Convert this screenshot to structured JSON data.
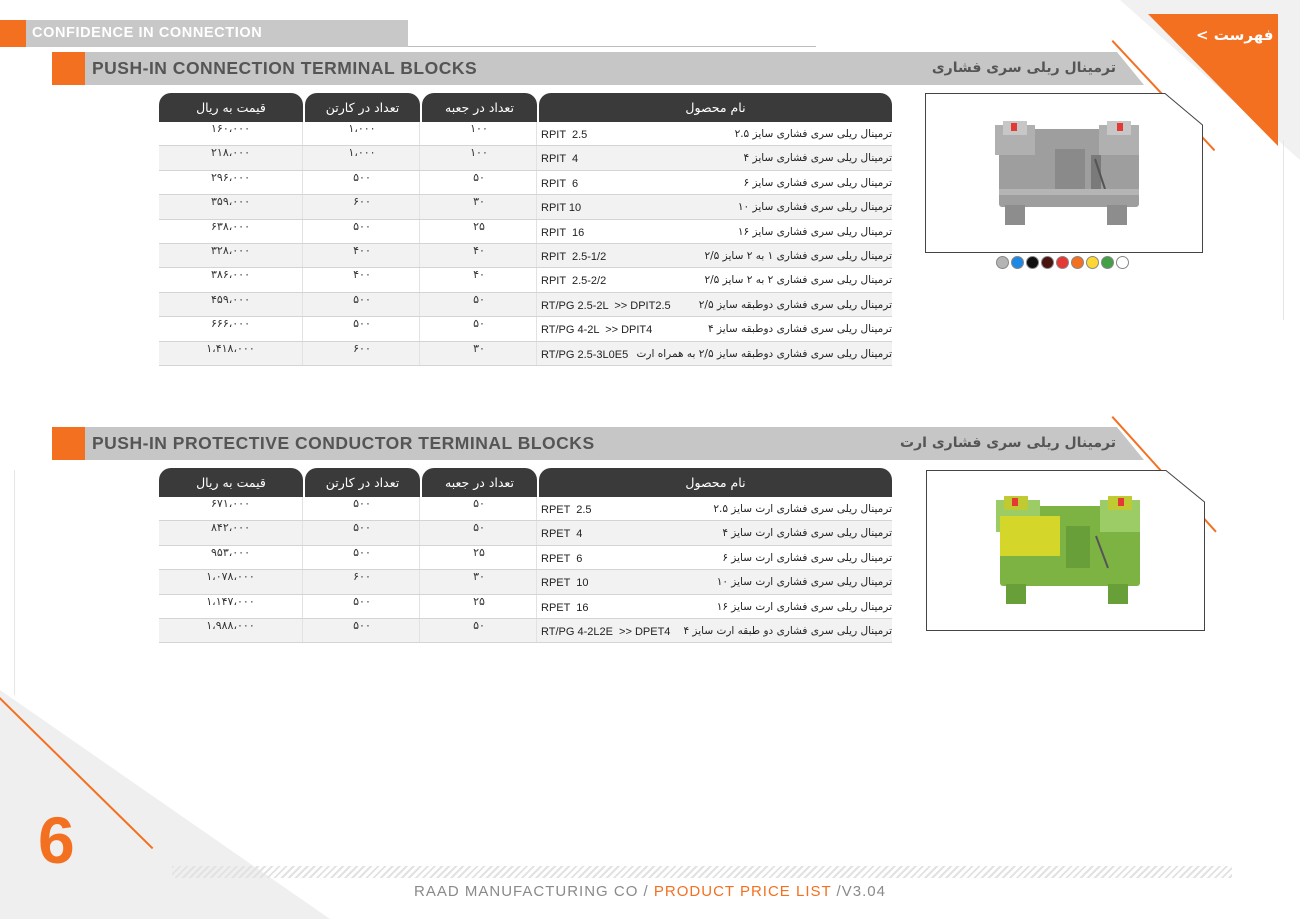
{
  "header": {
    "tagline": "CONFIDENCE IN CONNECTION",
    "menu_link": "< فهرست"
  },
  "colors": {
    "accent": "#f37021",
    "band": "#c6c6c6",
    "table_header": "#3a3a3a"
  },
  "table_headers": {
    "product_name": "نام محصول",
    "qty_box": "تعداد در جعبه",
    "qty_carton": "تعداد در کارتن",
    "price": "قیمت به ریال"
  },
  "section1": {
    "title_en": "PUSH-IN CONNECTION TERMINAL BLOCKS",
    "title_fa": "ترمینال ریلی سری فشاری",
    "rows": [
      {
        "name": "ترمینال ریلی سری فشاری سایز ۲.۵",
        "code": "RPIT  2.5",
        "box": "۱۰۰",
        "carton": "۱،۰۰۰",
        "price": "۱۶۰،۰۰۰"
      },
      {
        "name": "ترمینال ریلی سری فشاری سایز ۴",
        "code": "RPIT  4",
        "box": "۱۰۰",
        "carton": "۱،۰۰۰",
        "price": "۲۱۸،۰۰۰"
      },
      {
        "name": "ترمینال ریلی سری فشاری سایز ۶",
        "code": "RPIT  6",
        "box": "۵۰",
        "carton": "۵۰۰",
        "price": "۲۹۶،۰۰۰"
      },
      {
        "name": "ترمینال ریلی سری فشاری سایز ۱۰",
        "code": "RPIT 10",
        "box": "۳۰",
        "carton": "۶۰۰",
        "price": "۳۵۹،۰۰۰"
      },
      {
        "name": "ترمینال ریلی سری فشاری سایز ۱۶",
        "code": "RPIT  16",
        "box": "۲۵",
        "carton": "۵۰۰",
        "price": "۶۳۸،۰۰۰"
      },
      {
        "name": "ترمینال ریلی سری فشاری ۱ به ۲ سایز ۲/۵",
        "code": "RPIT  2.5-1/2",
        "box": "۴۰",
        "carton": "۴۰۰",
        "price": "۳۲۸،۰۰۰"
      },
      {
        "name": "ترمینال ریلی سری فشاری ۲ به ۲ سایز ۲/۵",
        "code": "RPIT  2.5-2/2",
        "box": "۴۰",
        "carton": "۴۰۰",
        "price": "۳۸۶،۰۰۰"
      },
      {
        "name": "ترمینال ریلی سری فشاری دوطبقه سایز ۲/۵",
        "code": "RT/PG 2.5-2L  >> DPIT2.5",
        "box": "۵۰",
        "carton": "۵۰۰",
        "price": "۴۵۹،۰۰۰"
      },
      {
        "name": "ترمینال ریلی سری فشاری دوطبقه سایز ۴",
        "code": "RT/PG 4-2L  >> DPIT4",
        "box": "۵۰",
        "carton": "۵۰۰",
        "price": "۶۶۶،۰۰۰"
      },
      {
        "name": "ترمینال ریلی سری فشاری دوطبقه سایز ۲/۵ به همراه ارت",
        "code": "RT/PG 2.5-3L0E5",
        "box": "۳۰",
        "carton": "۶۰۰",
        "price": "۱،۴۱۸،۰۰۰"
      }
    ],
    "color_options": [
      "#b4b4b4",
      "#1e88e5",
      "#111111",
      "#4a1410",
      "#e53935",
      "#f37021",
      "#fdd835",
      "#43a047",
      "#ffffff"
    ]
  },
  "section2": {
    "title_en": "PUSH-IN PROTECTIVE CONDUCTOR TERMINAL BLOCKS",
    "title_fa": "ترمینال ریلی سری فشاری ارت",
    "rows": [
      {
        "name": "ترمینال ریلی سری فشاری ارت سایز ۲.۵",
        "code": "RPET  2.5",
        "box": "۵۰",
        "carton": "۵۰۰",
        "price": "۶۷۱،۰۰۰"
      },
      {
        "name": "ترمینال ریلی سری فشاری ارت سایز ۴",
        "code": "RPET  4",
        "box": "۵۰",
        "carton": "۵۰۰",
        "price": "۸۴۲،۰۰۰"
      },
      {
        "name": "ترمینال ریلی سری فشاری ارت سایز ۶",
        "code": "RPET  6",
        "box": "۲۵",
        "carton": "۵۰۰",
        "price": "۹۵۳،۰۰۰"
      },
      {
        "name": "ترمینال ریلی سری فشاری ارت سایز ۱۰",
        "code": "RPET  10",
        "box": "۳۰",
        "carton": "۶۰۰",
        "price": "۱،۰۷۸،۰۰۰"
      },
      {
        "name": "ترمینال ریلی سری فشاری ارت سایز ۱۶",
        "code": "RPET  16",
        "box": "۲۵",
        "carton": "۵۰۰",
        "price": "۱،۱۴۷،۰۰۰"
      },
      {
        "name": "ترمینال ریلی سری فشاری دو طبقه ارت سایز ۴",
        "code": "RT/PG 4-2L2E  >> DPET4",
        "box": "۵۰",
        "carton": "۵۰۰",
        "price": "۱،۹۸۸،۰۰۰"
      }
    ]
  },
  "footer": {
    "page_number": "6",
    "company": "RAAD MANUFACTURING CO / ",
    "doc_title": "PRODUCT PRICE LIST",
    "version": " /V3.04"
  }
}
